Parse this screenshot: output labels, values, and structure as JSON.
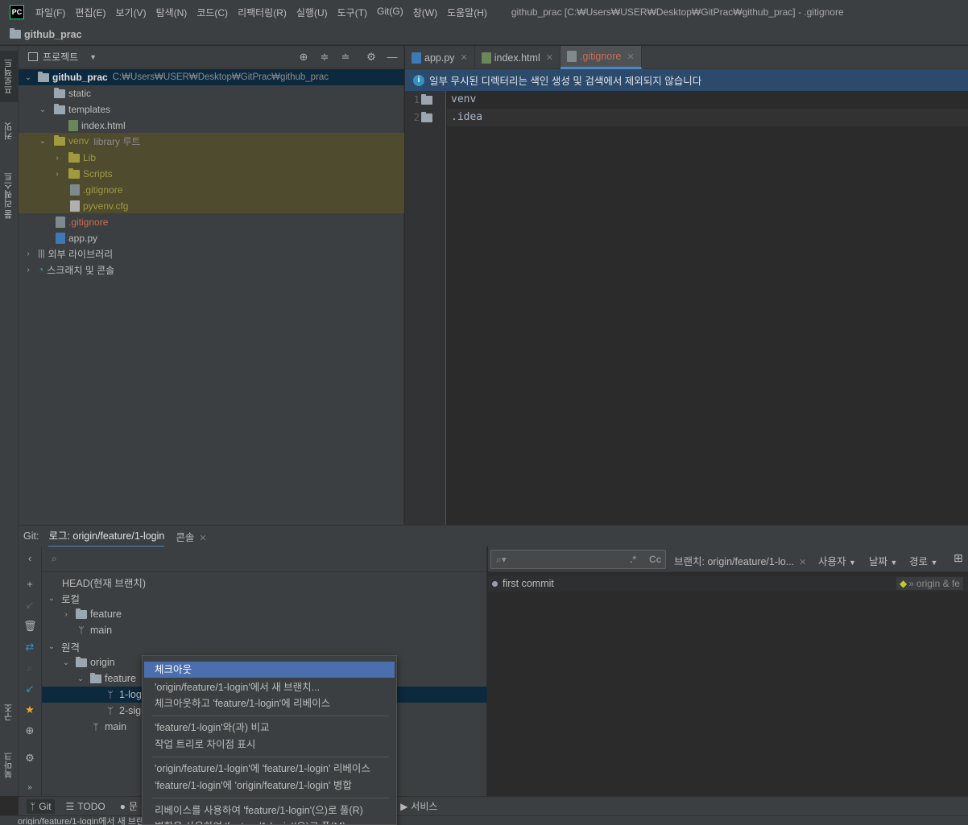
{
  "menubar": {
    "logo": "PC",
    "items": [
      "파일(F)",
      "편집(E)",
      "보기(V)",
      "탐색(N)",
      "코드(C)",
      "리팩터링(R)",
      "실행(U)",
      "도구(T)",
      "Git(G)",
      "창(W)",
      "도움말(H)"
    ],
    "window_title": "github_prac [C:₩Users₩USER₩Desktop₩GitPrac₩github_prac] - .gitignore"
  },
  "navbar": {
    "project": "github_prac"
  },
  "left_strip": {
    "tabs": [
      "프로젝트",
      "커밋",
      "풀 리퀘스트",
      "구조",
      "북마크"
    ]
  },
  "project_panel": {
    "title": "프로젝트",
    "tree": [
      {
        "label": "github_prac",
        "path": "C:₩Users₩USER₩Desktop₩GitPrac₩github_prac"
      },
      {
        "label": "static"
      },
      {
        "label": "templates"
      },
      {
        "label": "index.html"
      },
      {
        "label": "venv",
        "suffix": "library 루트"
      },
      {
        "label": "Lib"
      },
      {
        "label": "Scripts"
      },
      {
        "label": ".gitignore"
      },
      {
        "label": "pyvenv.cfg"
      },
      {
        "label": ".gitignore"
      },
      {
        "label": "app.py"
      },
      {
        "label": "외부 라이브러리"
      },
      {
        "label": "스크래치 및 콘솔"
      }
    ]
  },
  "editor": {
    "tabs": [
      {
        "label": "app.py"
      },
      {
        "label": "index.html"
      },
      {
        "label": ".gitignore"
      }
    ],
    "banner": "일부 무시된 디렉터리는 색인 생성 및 검색에서 제외되지 않습니다",
    "lines": [
      {
        "num": "1",
        "text": "venv"
      },
      {
        "num": "2",
        "text": ".idea"
      }
    ]
  },
  "git_window": {
    "prefix": "Git:",
    "tabs": [
      {
        "label": "로그: origin/feature/1-login"
      },
      {
        "label": "콘솔"
      }
    ],
    "branches": {
      "head": "HEAD(현재 브랜치)",
      "local": "로컬",
      "local_feature": "feature",
      "local_main": "main",
      "remote": "원격",
      "origin": "origin",
      "origin_feature": "feature",
      "branch_1": "1-login",
      "branch_2": "2-signup",
      "origin_main": "main"
    },
    "log": {
      "branch_filter": "브랜치: origin/feature/1-lo...",
      "user_filter": "사용자",
      "date_filter": "날짜",
      "path_filter": "경로",
      "regex_label": ".*",
      "case_label": "Cc",
      "commit_message": "first commit",
      "commit_refs": "origin & fe"
    }
  },
  "context_menu": {
    "items": [
      "체크아웃",
      "'origin/feature/1-login'에서 새 브랜치...",
      "체크아웃하고 'feature/1-login'에 리베이스",
      "'feature/1-login'와(과) 비교",
      "작업 트리로 차이점 표시",
      "'origin/feature/1-login'에 'feature/1-login' 리베이스",
      "'feature/1-login'에 'origin/feature/1-login' 병합",
      "리베이스를 사용하여 'feature/1-login'(으)로 풀(R)",
      "병합을 사용하여 'feature/1-login'(으)로 풀(M)"
    ]
  },
  "bottom_tabs": [
    "Git",
    "TODO",
    "문",
    "서비스"
  ],
  "status_bar": {
    "text": "origin/feature/1-login에서 새 브랜치..."
  },
  "colors": {
    "accent": "#4a88c7",
    "selection": "#4b6eaf",
    "ignored": "#cf6a4c",
    "venv": "#9f9a3d"
  }
}
